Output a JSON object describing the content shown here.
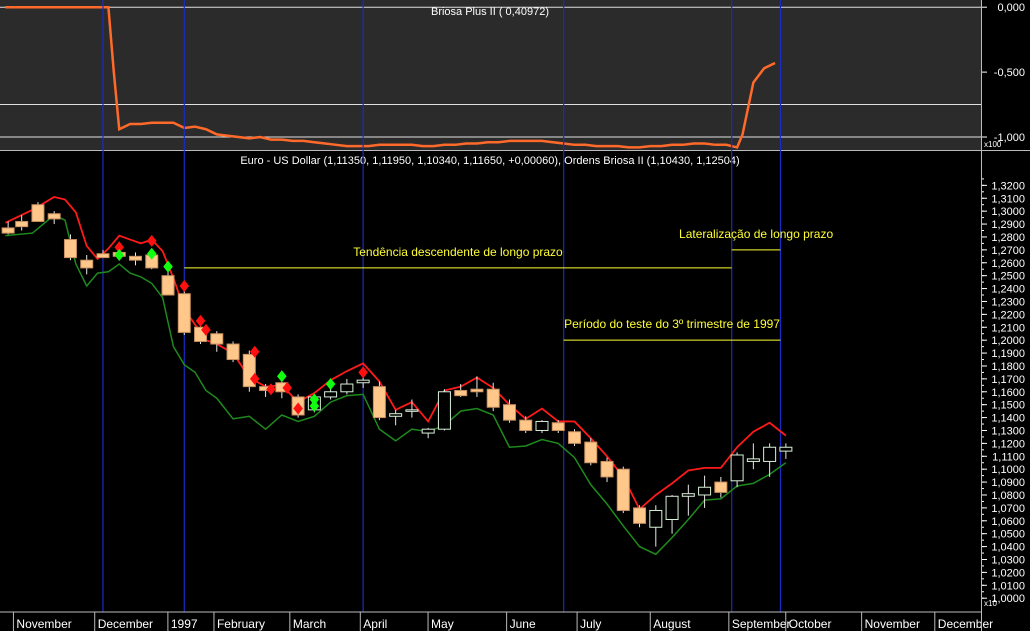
{
  "colors": {
    "indicator_bg": "#2b2b2b",
    "price_bg": "#000000",
    "indicator_line": "#ff6a2a",
    "upper_band": "#ff1a1a",
    "lower_band": "#1e8a1e",
    "candle_down": "#ffc88a",
    "candle_up": "#d9f0d9",
    "candle_outline": "#3a6a3a",
    "signal_sell": "#ff1010",
    "signal_buy": "#10ff10",
    "vline": "#1a2ac8",
    "annotation": "#ffff33",
    "grid": "#e0e0e0",
    "text": "#ffffff"
  },
  "chart_data": [
    {
      "type": "line",
      "title": "Briosa Plus II ( 0,40972)",
      "y_tick_labels": [
        "0,000",
        "-0,500",
        "-1,000"
      ],
      "y_ticks": [
        0,
        -0.5,
        -1.0
      ],
      "ylim": [
        -1.1,
        0.04
      ],
      "scale_label": "x100",
      "gridlines": [
        0,
        -0.75,
        -1.0
      ],
      "series": [
        {
          "x": [
            0,
            10,
            20,
            30,
            38,
            40,
            42,
            46,
            50,
            54,
            58,
            62,
            66,
            70,
            74,
            78,
            82,
            86,
            90,
            94,
            98,
            102,
            106,
            110,
            114,
            118,
            122,
            126,
            130,
            134,
            138,
            142,
            146,
            150,
            154,
            158,
            162,
            166,
            170,
            174,
            178,
            182,
            186,
            190,
            194,
            198,
            202,
            206,
            210,
            214,
            218,
            222,
            226,
            230,
            234,
            238,
            242,
            246,
            250,
            254,
            258,
            262,
            266,
            270,
            272,
            276,
            280,
            284
          ],
          "y": [
            0,
            0,
            0,
            0,
            0,
            -0.5,
            -0.94,
            -0.9,
            -0.9,
            -0.89,
            -0.89,
            -0.89,
            -0.93,
            -0.92,
            -0.94,
            -0.98,
            -0.99,
            -1.0,
            -1.01,
            -1.0,
            -1.02,
            -1.02,
            -1.03,
            -1.03,
            -1.04,
            -1.05,
            -1.06,
            -1.07,
            -1.07,
            -1.07,
            -1.06,
            -1.06,
            -1.06,
            -1.06,
            -1.07,
            -1.07,
            -1.06,
            -1.06,
            -1.05,
            -1.05,
            -1.04,
            -1.04,
            -1.03,
            -1.03,
            -1.03,
            -1.03,
            -1.04,
            -1.05,
            -1.06,
            -1.06,
            -1.07,
            -1.07,
            -1.07,
            -1.08,
            -1.08,
            -1.07,
            -1.07,
            -1.06,
            -1.06,
            -1.05,
            -1.05,
            -1.06,
            -1.06,
            -1.08,
            -0.98,
            -0.58,
            -0.47,
            -0.43
          ]
        }
      ]
    },
    {
      "type": "candlestick",
      "title": "Euro - US Dollar (1,11350, 1,11950, 1,10340, 1,11650, +0,00060), Ordens Briosa II (1,10430, 1,12504)",
      "ylim": [
        0.9955,
        1.335
      ],
      "y_tick_labels": [
        "1,3200",
        "1,3100",
        "1,3000",
        "1,2900",
        "1,2800",
        "1,2700",
        "1,2600",
        "1,2500",
        "1,2400",
        "1,2300",
        "1,2200",
        "1,2100",
        "1,2000",
        "1,1900",
        "1,1800",
        "1,1700",
        "1,1600",
        "1,1500",
        "1,1400",
        "1,1300",
        "1,1200",
        "1,1100",
        "1,1000",
        "1,0900",
        "1,0800",
        "1,0700",
        "1,0600",
        "1,0500",
        "1,0400",
        "1,0300",
        "1,0200",
        "1,0100",
        "1,0000"
      ],
      "y_ticks": [
        1.32,
        1.31,
        1.3,
        1.29,
        1.28,
        1.27,
        1.26,
        1.25,
        1.24,
        1.23,
        1.22,
        1.21,
        1.2,
        1.19,
        1.18,
        1.17,
        1.16,
        1.15,
        1.14,
        1.13,
        1.12,
        1.11,
        1.1,
        1.09,
        1.08,
        1.07,
        1.06,
        1.05,
        1.04,
        1.03,
        1.02,
        1.01,
        1.0
      ],
      "scale_label": "x10",
      "x_tick_labels": [
        "November",
        "December",
        "1997",
        "February",
        "March",
        "April",
        "May",
        "June",
        "July",
        "August",
        "September",
        "October",
        "November",
        "December"
      ],
      "x_ticks": [
        0,
        30,
        57,
        74,
        102,
        128,
        153,
        182,
        208,
        235,
        264,
        285,
        313,
        340
      ],
      "xlim": [
        -2,
        360
      ],
      "candles": [
        {
          "x": 1,
          "o": 1.287,
          "h": 1.292,
          "l": 1.282,
          "c": 1.283
        },
        {
          "x": 6,
          "o": 1.292,
          "h": 1.297,
          "l": 1.285,
          "c": 1.288
        },
        {
          "x": 12,
          "o": 1.305,
          "h": 1.307,
          "l": 1.292,
          "c": 1.292
        },
        {
          "x": 18,
          "o": 1.298,
          "h": 1.3,
          "l": 1.29,
          "c": 1.294
        },
        {
          "x": 24,
          "o": 1.278,
          "h": 1.282,
          "l": 1.262,
          "c": 1.264
        },
        {
          "x": 30,
          "o": 1.262,
          "h": 1.266,
          "l": 1.251,
          "c": 1.256
        },
        {
          "x": 36,
          "o": 1.267,
          "h": 1.27,
          "l": 1.265,
          "c": 1.264
        },
        {
          "x": 42,
          "o": 1.268,
          "h": 1.272,
          "l": 1.262,
          "c": 1.265
        },
        {
          "x": 48,
          "o": 1.265,
          "h": 1.268,
          "l": 1.258,
          "c": 1.262
        },
        {
          "x": 54,
          "o": 1.266,
          "h": 1.268,
          "l": 1.255,
          "c": 1.256
        },
        {
          "x": 60,
          "o": 1.25,
          "h": 1.253,
          "l": 1.235,
          "c": 1.235
        },
        {
          "x": 66,
          "o": 1.236,
          "h": 1.24,
          "l": 1.204,
          "c": 1.206
        },
        {
          "x": 72,
          "o": 1.21,
          "h": 1.214,
          "l": 1.197,
          "c": 1.199
        },
        {
          "x": 78,
          "o": 1.205,
          "h": 1.207,
          "l": 1.191,
          "c": 1.197
        },
        {
          "x": 84,
          "o": 1.197,
          "h": 1.199,
          "l": 1.183,
          "c": 1.185
        },
        {
          "x": 90,
          "o": 1.189,
          "h": 1.192,
          "l": 1.16,
          "c": 1.164
        },
        {
          "x": 96,
          "o": 1.164,
          "h": 1.166,
          "l": 1.156,
          "c": 1.161
        },
        {
          "x": 102,
          "o": 1.167,
          "h": 1.17,
          "l": 1.155,
          "c": 1.16
        },
        {
          "x": 108,
          "o": 1.156,
          "h": 1.158,
          "l": 1.14,
          "c": 1.142
        },
        {
          "x": 114,
          "o": 1.146,
          "h": 1.158,
          "l": 1.144,
          "c": 1.156
        },
        {
          "x": 120,
          "o": 1.156,
          "h": 1.166,
          "l": 1.154,
          "c": 1.16
        },
        {
          "x": 126,
          "o": 1.16,
          "h": 1.17,
          "l": 1.158,
          "c": 1.166
        },
        {
          "x": 132,
          "o": 1.167,
          "h": 1.172,
          "l": 1.163,
          "c": 1.169
        },
        {
          "x": 138,
          "o": 1.164,
          "h": 1.168,
          "l": 1.138,
          "c": 1.14
        },
        {
          "x": 144,
          "o": 1.141,
          "h": 1.146,
          "l": 1.134,
          "c": 1.143
        },
        {
          "x": 150,
          "o": 1.146,
          "h": 1.154,
          "l": 1.14,
          "c": 1.146
        },
        {
          "x": 156,
          "o": 1.128,
          "h": 1.132,
          "l": 1.124,
          "c": 1.131
        },
        {
          "x": 162,
          "o": 1.131,
          "h": 1.162,
          "l": 1.13,
          "c": 1.16
        },
        {
          "x": 168,
          "o": 1.161,
          "h": 1.166,
          "l": 1.156,
          "c": 1.157
        },
        {
          "x": 174,
          "o": 1.162,
          "h": 1.172,
          "l": 1.156,
          "c": 1.16
        },
        {
          "x": 180,
          "o": 1.162,
          "h": 1.167,
          "l": 1.145,
          "c": 1.148
        },
        {
          "x": 186,
          "o": 1.15,
          "h": 1.154,
          "l": 1.136,
          "c": 1.138
        },
        {
          "x": 192,
          "o": 1.138,
          "h": 1.141,
          "l": 1.128,
          "c": 1.13
        },
        {
          "x": 198,
          "o": 1.13,
          "h": 1.138,
          "l": 1.128,
          "c": 1.137
        },
        {
          "x": 204,
          "o": 1.136,
          "h": 1.138,
          "l": 1.128,
          "c": 1.13
        },
        {
          "x": 210,
          "o": 1.129,
          "h": 1.131,
          "l": 1.118,
          "c": 1.12
        },
        {
          "x": 216,
          "o": 1.121,
          "h": 1.124,
          "l": 1.103,
          "c": 1.105
        },
        {
          "x": 222,
          "o": 1.106,
          "h": 1.109,
          "l": 1.09,
          "c": 1.094
        },
        {
          "x": 228,
          "o": 1.1,
          "h": 1.102,
          "l": 1.066,
          "c": 1.068
        },
        {
          "x": 234,
          "o": 1.07,
          "h": 1.072,
          "l": 1.055,
          "c": 1.058
        },
        {
          "x": 240,
          "o": 1.055,
          "h": 1.072,
          "l": 1.04,
          "c": 1.068
        },
        {
          "x": 246,
          "o": 1.061,
          "h": 1.08,
          "l": 1.05,
          "c": 1.079
        },
        {
          "x": 252,
          "o": 1.079,
          "h": 1.088,
          "l": 1.064,
          "c": 1.081
        },
        {
          "x": 258,
          "o": 1.08,
          "h": 1.095,
          "l": 1.07,
          "c": 1.086
        },
        {
          "x": 264,
          "o": 1.09,
          "h": 1.094,
          "l": 1.078,
          "c": 1.082
        },
        {
          "x": 270,
          "o": 1.091,
          "h": 1.113,
          "l": 1.086,
          "c": 1.111
        },
        {
          "x": 276,
          "o": 1.106,
          "h": 1.12,
          "l": 1.1,
          "c": 1.108
        },
        {
          "x": 282,
          "o": 1.106,
          "h": 1.12,
          "l": 1.094,
          "c": 1.117
        },
        {
          "x": 288,
          "o": 1.114,
          "h": 1.12,
          "l": 1.108,
          "c": 1.117
        }
      ],
      "upper_band": {
        "x": [
          0,
          10,
          18,
          22,
          26,
          30,
          34,
          38,
          42,
          46,
          50,
          54,
          58,
          62,
          66,
          70,
          74,
          78,
          84,
          90,
          96,
          102,
          108,
          114,
          120,
          126,
          132,
          138,
          144,
          150,
          156,
          162,
          168,
          174,
          180,
          186,
          192,
          198,
          204,
          210,
          216,
          222,
          228,
          234,
          240,
          246,
          252,
          258,
          264,
          270,
          276,
          282,
          288
        ],
        "y": [
          1.291,
          1.301,
          1.311,
          1.309,
          1.299,
          1.273,
          1.263,
          1.271,
          1.281,
          1.278,
          1.275,
          1.278,
          1.269,
          1.248,
          1.224,
          1.212,
          1.2,
          1.197,
          1.19,
          1.171,
          1.164,
          1.165,
          1.152,
          1.159,
          1.169,
          1.176,
          1.182,
          1.168,
          1.146,
          1.152,
          1.137,
          1.161,
          1.164,
          1.171,
          1.163,
          1.15,
          1.139,
          1.147,
          1.137,
          1.137,
          1.124,
          1.11,
          1.094,
          1.069,
          1.08,
          1.089,
          1.099,
          1.101,
          1.101,
          1.117,
          1.129,
          1.136,
          1.126
        ]
      },
      "lower_band": {
        "x": [
          0,
          10,
          18,
          22,
          26,
          30,
          34,
          38,
          42,
          46,
          50,
          54,
          58,
          62,
          66,
          70,
          74,
          78,
          84,
          90,
          96,
          102,
          108,
          114,
          120,
          126,
          132,
          138,
          144,
          150,
          156,
          162,
          168,
          174,
          180,
          186,
          192,
          198,
          204,
          210,
          216,
          222,
          228,
          234,
          240,
          246,
          252,
          258,
          264,
          270,
          276,
          282,
          288
        ],
        "y": [
          1.281,
          1.283,
          1.297,
          1.293,
          1.259,
          1.242,
          1.252,
          1.253,
          1.259,
          1.252,
          1.249,
          1.244,
          1.233,
          1.195,
          1.181,
          1.175,
          1.161,
          1.155,
          1.139,
          1.141,
          1.131,
          1.142,
          1.137,
          1.141,
          1.152,
          1.157,
          1.158,
          1.131,
          1.122,
          1.131,
          1.129,
          1.134,
          1.145,
          1.147,
          1.142,
          1.117,
          1.118,
          1.123,
          1.12,
          1.109,
          1.088,
          1.073,
          1.056,
          1.04,
          1.034,
          1.047,
          1.061,
          1.076,
          1.077,
          1.087,
          1.089,
          1.096,
          1.105
        ]
      },
      "sell_signals": [
        {
          "x": 42,
          "y": 1.272
        },
        {
          "x": 54,
          "y": 1.277
        },
        {
          "x": 66,
          "y": 1.242
        },
        {
          "x": 72,
          "y": 1.215
        },
        {
          "x": 74,
          "y": 1.208
        },
        {
          "x": 92,
          "y": 1.191
        },
        {
          "x": 92,
          "y": 1.17
        },
        {
          "x": 98,
          "y": 1.162
        },
        {
          "x": 104,
          "y": 1.163
        },
        {
          "x": 108,
          "y": 1.147
        },
        {
          "x": 132,
          "y": 1.175
        }
      ],
      "buy_signals": [
        {
          "x": 42,
          "y": 1.266
        },
        {
          "x": 54,
          "y": 1.267
        },
        {
          "x": 60,
          "y": 1.257
        },
        {
          "x": 102,
          "y": 1.172
        },
        {
          "x": 114,
          "y": 1.154
        },
        {
          "x": 114,
          "y": 1.149
        },
        {
          "x": 120,
          "y": 1.166
        }
      ],
      "annotations": [
        {
          "label": "Tendência descendente de longo prazo",
          "x0": 66,
          "x1": 268,
          "y": 1.256
        },
        {
          "label": "Lateralização de longo prazo",
          "x0": 268,
          "x1": 286,
          "y": 1.27
        },
        {
          "label": "Período do teste do 3º trimestre de 1997",
          "x0": 206,
          "x1": 286,
          "y": 1.2
        }
      ],
      "vertical_lines": [
        36,
        66,
        132,
        206,
        268,
        286
      ]
    }
  ]
}
